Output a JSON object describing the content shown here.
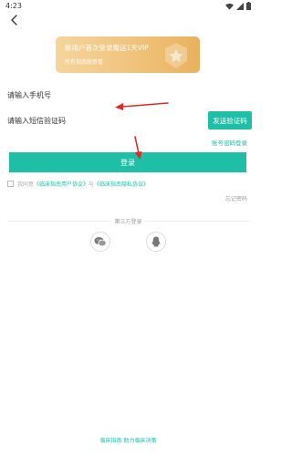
{
  "status_bar": {
    "time": "4:23"
  },
  "banner": {
    "title": "新用户首次登录赠送1天VIP",
    "subtitle": "所有指南随意看"
  },
  "form": {
    "phone_placeholder": "请输入手机号",
    "code_placeholder": "请输入短信验证码",
    "send_code_label": "发送验证码",
    "password_login_label": "账号密码登录",
    "login_label": "登录"
  },
  "agreement": {
    "prefix": "我同意",
    "user_agreement": "《临床指南用户协议》",
    "connector": "与",
    "privacy_policy": "《临床指南隐私协议》"
  },
  "forgot_password_label": "忘记密码",
  "third_party": {
    "label": "第三方登录"
  },
  "footer": {
    "slogan": "临床指南 助力临床决策"
  },
  "colors": {
    "accent": "#1fbfa5",
    "banner": "#efc178",
    "arrow": "#e02a2a"
  }
}
